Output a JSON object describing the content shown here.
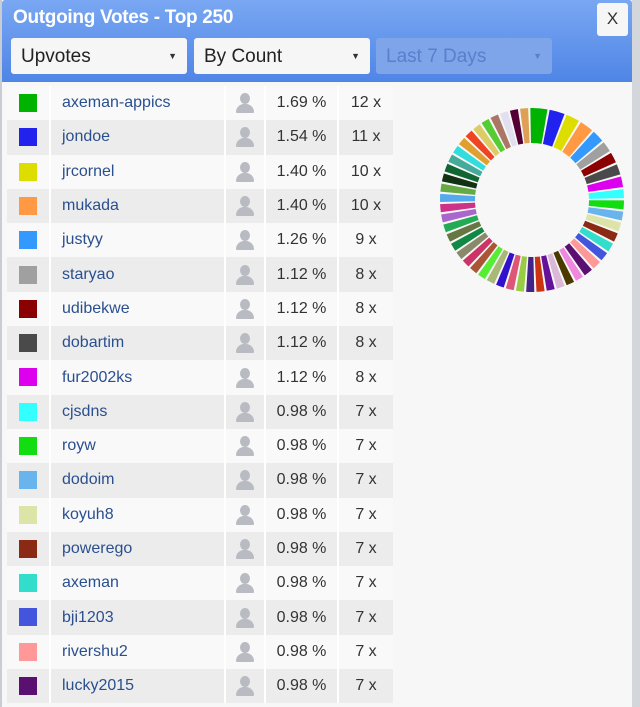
{
  "header": {
    "title": "Outgoing Votes - Top 250",
    "close_label": "X"
  },
  "filters": [
    {
      "selected": "Upvotes",
      "disabled": false
    },
    {
      "selected": "By Count",
      "disabled": false
    },
    {
      "selected": "Last 7 Days",
      "disabled": true
    }
  ],
  "rows": [
    {
      "color": "#00b300",
      "name": "axeman-appics",
      "pct": "1.69 %",
      "count": "12 x"
    },
    {
      "color": "#2222ee",
      "name": "jondoe",
      "pct": "1.54 %",
      "count": "11 x"
    },
    {
      "color": "#dddd00",
      "name": "jrcornel",
      "pct": "1.40 %",
      "count": "10 x"
    },
    {
      "color": "#ff9944",
      "name": "mukada",
      "pct": "1.40 %",
      "count": "10 x"
    },
    {
      "color": "#3399ff",
      "name": "justyy",
      "pct": "1.26 %",
      "count": "9 x"
    },
    {
      "color": "#a0a0a0",
      "name": "staryao",
      "pct": "1.12 %",
      "count": "8 x"
    },
    {
      "color": "#8b0000",
      "name": "udibekwe",
      "pct": "1.12 %",
      "count": "8 x"
    },
    {
      "color": "#4a4a4a",
      "name": "dobartim",
      "pct": "1.12 %",
      "count": "8 x"
    },
    {
      "color": "#dd00ee",
      "name": "fur2002ks",
      "pct": "1.12 %",
      "count": "8 x"
    },
    {
      "color": "#33ffff",
      "name": "cjsdns",
      "pct": "0.98 %",
      "count": "7 x"
    },
    {
      "color": "#11dd11",
      "name": "royw",
      "pct": "0.98 %",
      "count": "7 x"
    },
    {
      "color": "#6ab4ee",
      "name": "dodoim",
      "pct": "0.98 %",
      "count": "7 x"
    },
    {
      "color": "#dde4a8",
      "name": "koyuh8",
      "pct": "0.98 %",
      "count": "7 x"
    },
    {
      "color": "#8a2a14",
      "name": "powerego",
      "pct": "0.98 %",
      "count": "7 x"
    },
    {
      "color": "#33ddcc",
      "name": "axeman",
      "pct": "0.98 %",
      "count": "7 x"
    },
    {
      "color": "#4455dd",
      "name": "bji1203",
      "pct": "0.98 %",
      "count": "7 x"
    },
    {
      "color": "#ff9999",
      "name": "rivershu2",
      "pct": "0.98 %",
      "count": "7 x"
    },
    {
      "color": "#5a1070",
      "name": "lucky2015",
      "pct": "0.98 %",
      "count": "7 x"
    }
  ],
  "chart_data": {
    "type": "pie",
    "donut": true,
    "values_pct": [
      1.69,
      1.54,
      1.4,
      1.4,
      1.26,
      1.12,
      1.12,
      1.12,
      1.12,
      0.98,
      0.98,
      0.98,
      0.98,
      0.98,
      0.98,
      0.98,
      0.98,
      0.98
    ],
    "colors": [
      "#00b300",
      "#2222ee",
      "#dddd00",
      "#ff9944",
      "#3399ff",
      "#a0a0a0",
      "#8b0000",
      "#4a4a4a",
      "#dd00ee",
      "#33ffff",
      "#11dd11",
      "#6ab4ee",
      "#dde4a8",
      "#8a2a14",
      "#33ddcc",
      "#4455dd",
      "#ff9999",
      "#5a1070"
    ],
    "other_slice_colors": [
      "#ee88dd",
      "#4a3a00",
      "#dcb8d8",
      "#661199",
      "#cc3311",
      "#442288",
      "#99cc44",
      "#dd5577",
      "#3311cc",
      "#aab877",
      "#55ee33",
      "#aa5533",
      "#cc3366",
      "#8a8a6a",
      "#118844",
      "#667744",
      "#22aa55",
      "#aa66cc",
      "#cc3388",
      "#55aaee",
      "#66aa44",
      "#113311",
      "#116633",
      "#44aa99",
      "#33dddd",
      "#e0a030",
      "#ee4422",
      "#ddcc66",
      "#55cc33",
      "#aa7766",
      "#e0e0ee",
      "#550033",
      "#dda055"
    ]
  }
}
